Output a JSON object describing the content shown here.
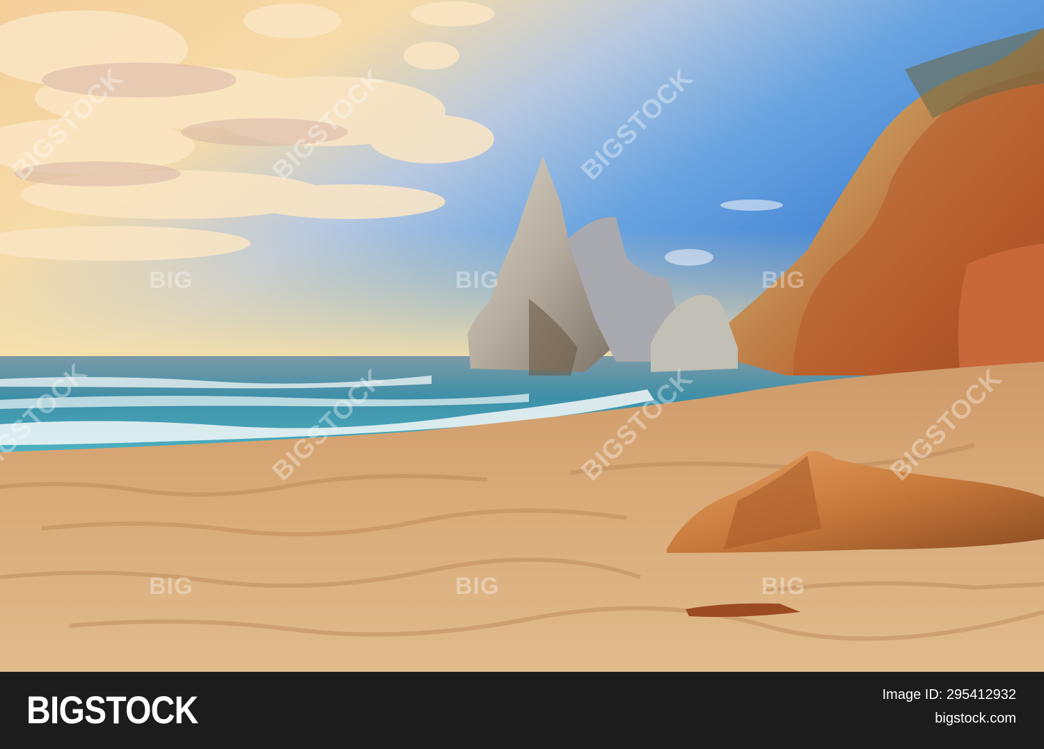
{
  "watermark": {
    "diagonal_text": "BIGSTOCK",
    "big_text": "BIG"
  },
  "footer": {
    "brand": "BIGSTOCK",
    "image_id": "Image ID: 295412932",
    "site": "bigstock.com"
  },
  "colors": {
    "footer_background": "#1c1c1c",
    "sky_blue": "#3e86d8",
    "sunset_gold": "#f7d58e",
    "sea_teal": "#4fb6c4",
    "sand": "#d7a874",
    "cliff_orange": "#b8602e"
  }
}
